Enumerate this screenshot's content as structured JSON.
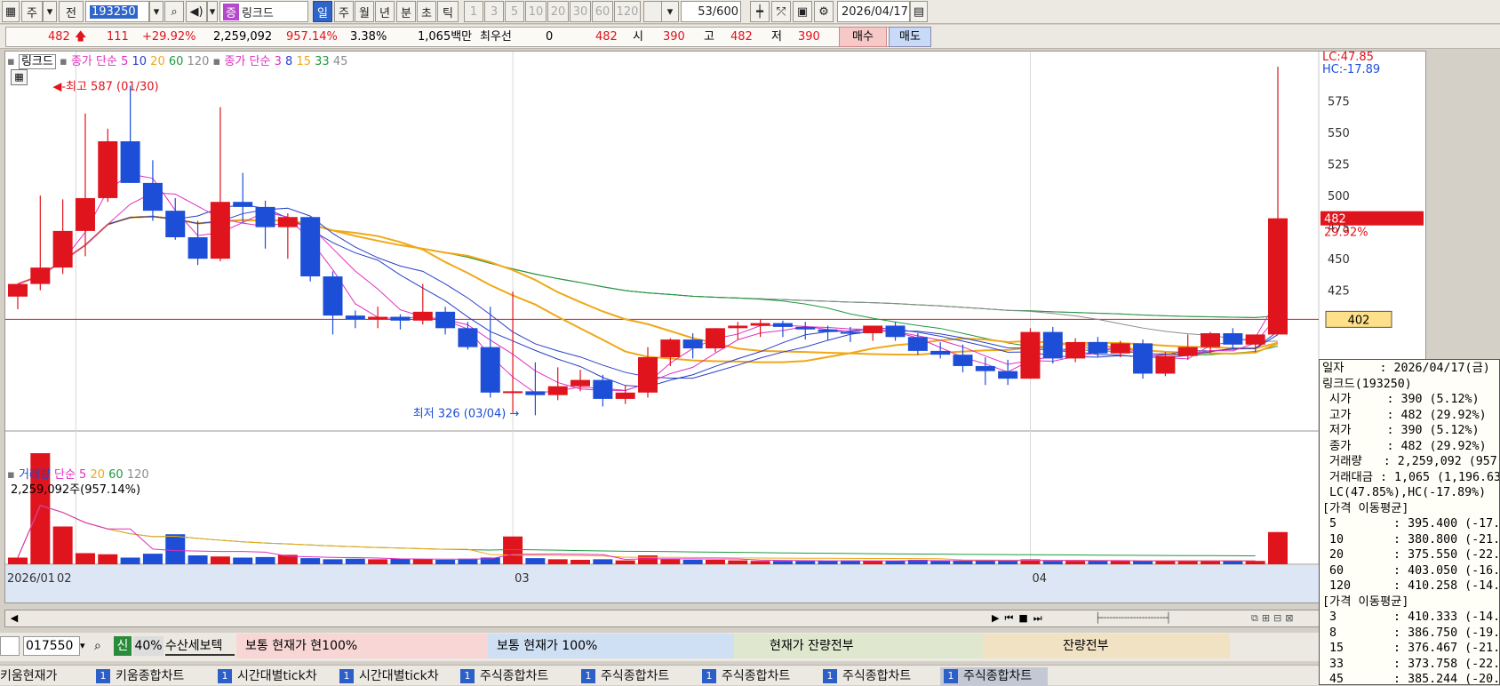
{
  "toolbar": {
    "buttons": [
      {
        "id": "ju",
        "label": "주"
      },
      {
        "id": "jeon",
        "label": "전"
      },
      {
        "id": "code",
        "label": "193250"
      },
      {
        "id": "name_badge",
        "label": "증"
      },
      {
        "id": "name",
        "label": "링크드"
      },
      {
        "id": "il",
        "label": "일"
      },
      {
        "id": "ju2",
        "label": "주"
      },
      {
        "id": "wol",
        "label": "월"
      },
      {
        "id": "nyeon",
        "label": "년"
      },
      {
        "id": "bun",
        "label": "분"
      },
      {
        "id": "cho",
        "label": "초"
      },
      {
        "id": "tik",
        "label": "틱"
      },
      {
        "id": "n1",
        "label": "1"
      },
      {
        "id": "n3",
        "label": "3"
      },
      {
        "id": "n5",
        "label": "5"
      },
      {
        "id": "n10",
        "label": "10"
      },
      {
        "id": "n20",
        "label": "20"
      },
      {
        "id": "n30",
        "label": "30"
      },
      {
        "id": "n60",
        "label": "60"
      },
      {
        "id": "n120",
        "label": "120"
      }
    ],
    "count_current": "53",
    "count_total": "/600",
    "date": "2026/04/17"
  },
  "infobar": {
    "price": "482",
    "change": "111",
    "change_pct": "+29.92%",
    "volume": "2,259,092",
    "volume_ratio": "957.14%",
    "turnover": "3.38%",
    "amount": "1,065백만",
    "priority_label": "최우선",
    "priority_qty": "0",
    "priority_price": "482",
    "open_label": "시",
    "open": "390",
    "high_label": "고",
    "high": "482",
    "low_label": "저",
    "low": "390",
    "buy": "매수",
    "sell": "매도"
  },
  "legend_price": {
    "name": "링크드",
    "ma_label": "종가 단순",
    "ma": [
      "5",
      "10",
      "20",
      "60",
      "120"
    ],
    "ma2_label": "종가 단순",
    "ma2": [
      "3",
      "8",
      "15",
      "33",
      "45"
    ]
  },
  "legend_volume": {
    "name": "거래량",
    "ma_label": "단순",
    "ma": [
      "5",
      "20",
      "60",
      "120"
    ],
    "value": "2,259,092주(957.14%)"
  },
  "annotations": {
    "high": "최고 587 (01/30)",
    "low": "최저 326 (03/04)",
    "lc": "LC:47.85",
    "hc": "HC:-17.89",
    "last_price": "482",
    "last_pct": "29.92%",
    "ref_price": "402"
  },
  "colors": {
    "up": "#e0141c",
    "down": "#1c4ed8",
    "ma5": "#e12fc0",
    "ma10": "#2a3fc8",
    "ma20": "#f0a818",
    "ma60": "#1e9a3c",
    "ma120": "#8c8c8c"
  },
  "chart_data": {
    "type": "candlestick",
    "y_ticks": [
      "575",
      "550",
      "525",
      "500",
      "475",
      "450",
      "425",
      "402"
    ],
    "ylim": [
      315,
      600
    ],
    "x_labels": [
      "2026/01",
      "02",
      "03",
      "04"
    ],
    "candles": [
      {
        "date": "01/23",
        "o": 420,
        "h": 423,
        "l": 410,
        "c": 430
      },
      {
        "date": "01/26",
        "o": 430,
        "h": 500,
        "l": 425,
        "c": 443
      },
      {
        "date": "01/27",
        "o": 443,
        "h": 497,
        "l": 438,
        "c": 472
      },
      {
        "date": "01/28",
        "o": 472,
        "h": 565,
        "l": 452,
        "c": 498
      },
      {
        "date": "01/29",
        "o": 498,
        "h": 553,
        "l": 495,
        "c": 543
      },
      {
        "date": "01/30",
        "o": 543,
        "h": 587,
        "l": 510,
        "c": 510
      },
      {
        "date": "02/02",
        "o": 510,
        "h": 528,
        "l": 480,
        "c": 488
      },
      {
        "date": "02/03",
        "o": 488,
        "h": 498,
        "l": 465,
        "c": 467
      },
      {
        "date": "02/04",
        "o": 467,
        "h": 480,
        "l": 445,
        "c": 450
      },
      {
        "date": "02/05",
        "o": 450,
        "h": 570,
        "l": 448,
        "c": 495
      },
      {
        "date": "02/06",
        "o": 495,
        "h": 518,
        "l": 478,
        "c": 491
      },
      {
        "date": "02/09",
        "o": 491,
        "h": 496,
        "l": 458,
        "c": 475
      },
      {
        "date": "02/10",
        "o": 475,
        "h": 486,
        "l": 450,
        "c": 483
      },
      {
        "date": "02/11",
        "o": 483,
        "h": 483,
        "l": 432,
        "c": 436
      },
      {
        "date": "02/12",
        "o": 436,
        "h": 440,
        "l": 390,
        "c": 405
      },
      {
        "date": "02/13",
        "o": 405,
        "h": 409,
        "l": 395,
        "c": 402
      },
      {
        "date": "02/19",
        "o": 402,
        "h": 412,
        "l": 395,
        "c": 404
      },
      {
        "date": "02/20",
        "o": 404,
        "h": 406,
        "l": 394,
        "c": 401
      },
      {
        "date": "02/23",
        "o": 401,
        "h": 430,
        "l": 398,
        "c": 408
      },
      {
        "date": "02/24",
        "o": 408,
        "h": 412,
        "l": 390,
        "c": 395
      },
      {
        "date": "02/25",
        "o": 395,
        "h": 400,
        "l": 378,
        "c": 380
      },
      {
        "date": "02/26",
        "o": 380,
        "h": 412,
        "l": 340,
        "c": 344
      },
      {
        "date": "02/27",
        "o": 344,
        "h": 424,
        "l": 328,
        "c": 345
      },
      {
        "date": "03/03",
        "o": 345,
        "h": 368,
        "l": 326,
        "c": 342
      },
      {
        "date": "03/04",
        "o": 342,
        "h": 364,
        "l": 338,
        "c": 349
      },
      {
        "date": "03/05",
        "o": 349,
        "h": 362,
        "l": 345,
        "c": 354
      },
      {
        "date": "03/06",
        "o": 354,
        "h": 358,
        "l": 333,
        "c": 339
      },
      {
        "date": "03/09",
        "o": 339,
        "h": 350,
        "l": 335,
        "c": 344
      },
      {
        "date": "03/10",
        "o": 344,
        "h": 380,
        "l": 340,
        "c": 372
      },
      {
        "date": "03/11",
        "o": 372,
        "h": 387,
        "l": 365,
        "c": 386
      },
      {
        "date": "03/12",
        "o": 386,
        "h": 391,
        "l": 371,
        "c": 379
      },
      {
        "date": "03/13",
        "o": 379,
        "h": 395,
        "l": 376,
        "c": 395
      },
      {
        "date": "03/16",
        "o": 395,
        "h": 400,
        "l": 386,
        "c": 397
      },
      {
        "date": "03/17",
        "o": 397,
        "h": 402,
        "l": 388,
        "c": 399
      },
      {
        "date": "03/18",
        "o": 399,
        "h": 401,
        "l": 388,
        "c": 396
      },
      {
        "date": "03/19",
        "o": 396,
        "h": 400,
        "l": 386,
        "c": 394
      },
      {
        "date": "03/20",
        "o": 394,
        "h": 397,
        "l": 385,
        "c": 392
      },
      {
        "date": "03/23",
        "o": 392,
        "h": 396,
        "l": 384,
        "c": 391
      },
      {
        "date": "03/24",
        "o": 391,
        "h": 397,
        "l": 385,
        "c": 397
      },
      {
        "date": "03/25",
        "o": 397,
        "h": 400,
        "l": 385,
        "c": 388
      },
      {
        "date": "03/26",
        "o": 388,
        "h": 391,
        "l": 374,
        "c": 377
      },
      {
        "date": "03/27",
        "o": 377,
        "h": 384,
        "l": 371,
        "c": 374
      },
      {
        "date": "03/30",
        "o": 374,
        "h": 382,
        "l": 360,
        "c": 365
      },
      {
        "date": "03/31",
        "o": 365,
        "h": 372,
        "l": 350,
        "c": 361
      },
      {
        "date": "04/01",
        "o": 361,
        "h": 370,
        "l": 350,
        "c": 355
      },
      {
        "date": "04/02",
        "o": 355,
        "h": 395,
        "l": 355,
        "c": 392
      },
      {
        "date": "04/03",
        "o": 392,
        "h": 396,
        "l": 367,
        "c": 371
      },
      {
        "date": "04/06",
        "o": 371,
        "h": 387,
        "l": 368,
        "c": 384
      },
      {
        "date": "04/07",
        "o": 384,
        "h": 388,
        "l": 372,
        "c": 375
      },
      {
        "date": "04/08",
        "o": 375,
        "h": 385,
        "l": 372,
        "c": 383
      },
      {
        "date": "04/09",
        "o": 383,
        "h": 386,
        "l": 355,
        "c": 359
      },
      {
        "date": "04/10",
        "o": 359,
        "h": 376,
        "l": 357,
        "c": 373
      },
      {
        "date": "04/13",
        "o": 373,
        "h": 390,
        "l": 370,
        "c": 380
      },
      {
        "date": "04/14",
        "o": 380,
        "h": 392,
        "l": 375,
        "c": 391
      },
      {
        "date": "04/15",
        "o": 391,
        "h": 395,
        "l": 378,
        "c": 382
      },
      {
        "date": "04/16",
        "o": 382,
        "h": 390,
        "l": 376,
        "c": 390
      },
      {
        "date": "04/17",
        "o": 390,
        "h": 602,
        "l": 390,
        "c": 482
      }
    ],
    "volumes": [
      60,
      1000,
      340,
      100,
      90,
      60,
      95,
      270,
      80,
      70,
      60,
      65,
      85,
      55,
      45,
      50,
      45,
      50,
      45,
      40,
      50,
      60,
      250,
      55,
      45,
      40,
      45,
      35,
      80,
      45,
      40,
      40,
      35,
      30,
      30,
      30,
      30,
      35,
      30,
      30,
      40,
      30,
      30,
      35,
      30,
      45,
      30,
      30,
      30,
      30,
      30,
      30,
      30,
      30,
      30,
      30,
      290
    ]
  },
  "popup": {
    "lines": [
      "일자     : 2026/04/17(금)",
      "링크드(193250)",
      " 시가     : 390 (5.12%)",
      " 고가     : 482 (29.92%)",
      " 저가     : 390 (5.12%)",
      " 종가     : 482 (29.92%)",
      " 거래량   : 2,259,092 (957.",
      " 거래대금 : 1,065 (1,196.63",
      " LC(47.85%),HC(-17.89%)",
      "[가격 이동평균]",
      " 5        : 395.400 (-17.97",
      " 10       : 380.800 (-21.00",
      " 20       : 375.550 (-22.09",
      " 60       : 403.050 (-16.38",
      " 120      : 410.258 (-14.88",
      "[가격 이동평균]",
      " 3        : 410.333 (-14.87",
      " 8        : 386.750 (-19.76",
      " 15       : 376.467 (-21.89",
      " 33       : 373.758 (-22.46",
      " 45       : 385.244 (-20.07"
    ]
  },
  "bottombar": {
    "code": "017550",
    "sin": "신",
    "pct": "40%",
    "tab": "수산세보텍",
    "pill1": "보통   현재가   현100%",
    "pill2": "보통   현재가    100%",
    "pill3": "현재가    잔량전부",
    "pill4": "잔량전부"
  },
  "taskbar": {
    "items": [
      {
        "num": "",
        "label": "키움현재가"
      },
      {
        "num": "1",
        "label": "키움종합차트"
      },
      {
        "num": "1",
        "label": "시간대별tick차"
      },
      {
        "num": "1",
        "label": "시간대별tick차"
      },
      {
        "num": "1",
        "label": "주식종합차트"
      },
      {
        "num": "1",
        "label": "주식종합차트"
      },
      {
        "num": "1",
        "label": "주식종합차트"
      },
      {
        "num": "1",
        "label": "주식종합차트"
      },
      {
        "num": "1",
        "label": "주식종합차트"
      }
    ]
  }
}
